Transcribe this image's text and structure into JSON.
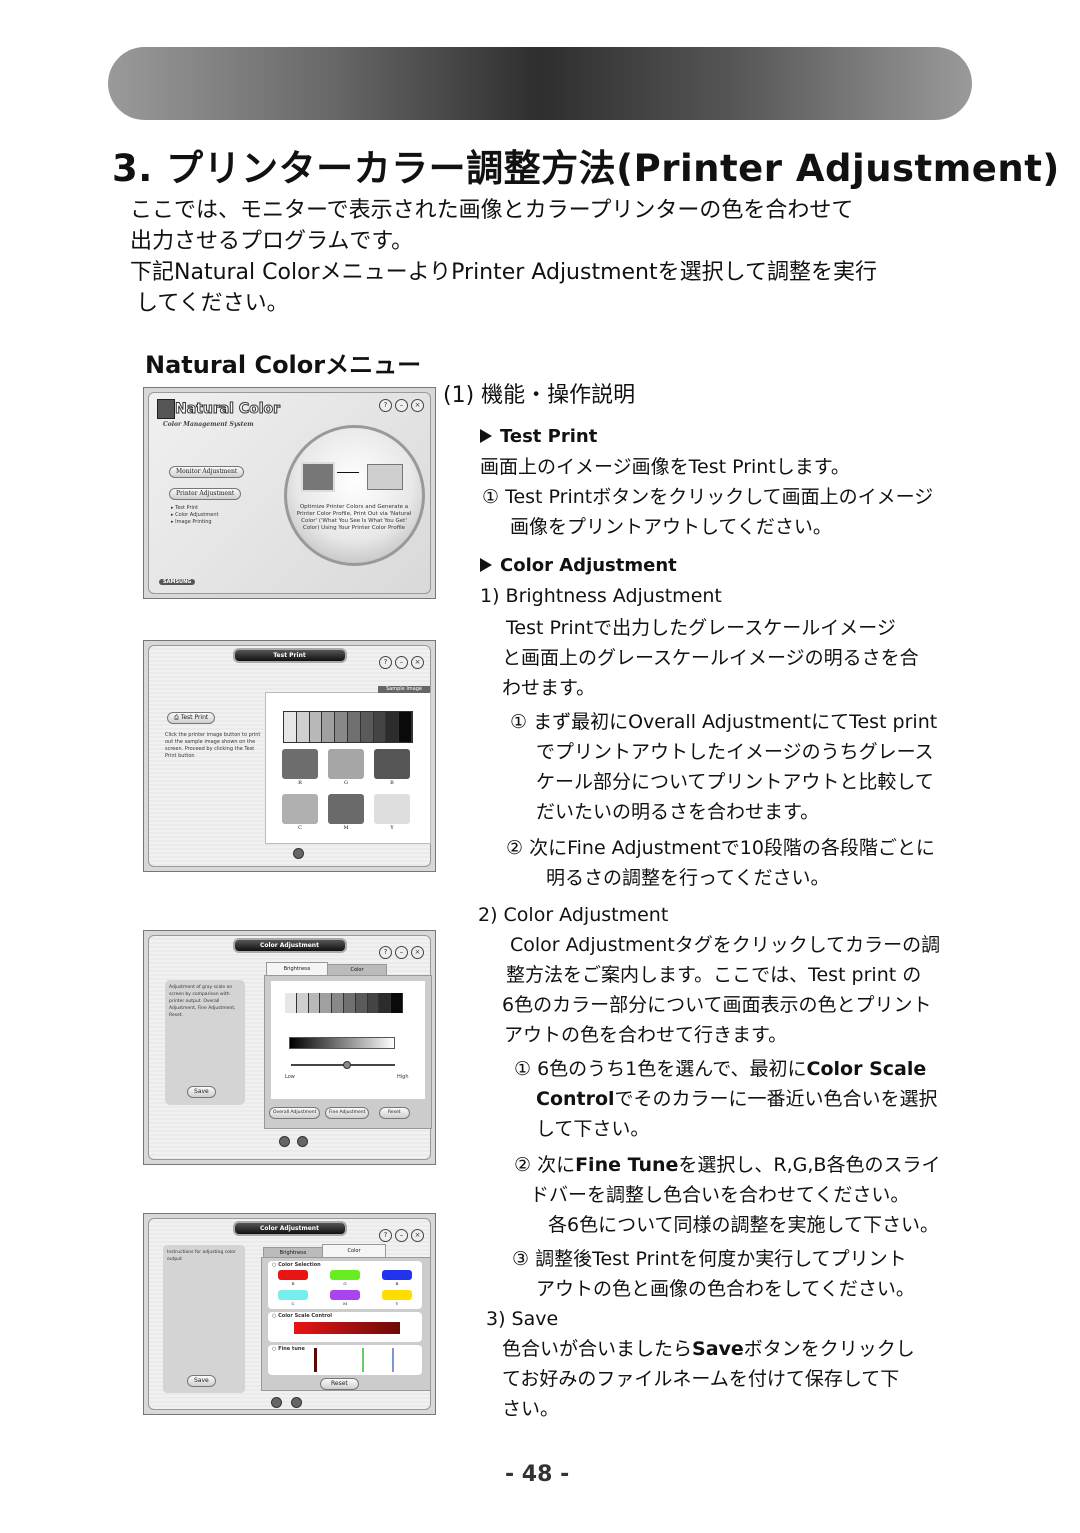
{
  "header": {
    "title": "3. プリンターカラー調整方法(Printer Adjustment)"
  },
  "intro": {
    "lines": [
      "ここでは、モニターで表示された画像とカラープリンターの色を合わせて",
      "出力させるプログラムです。",
      "下記Natural ColorメニューよりPrinter Adjustmentを選択して調整を実行",
      "してください。"
    ]
  },
  "menu_heading": "Natural Colorメニュー",
  "function_heading": "(1) 機能・操作説明",
  "sections": {
    "test_print": {
      "title": "Test Print",
      "lines": [
        "画面上のイメージ画像をTest Printします。",
        "① Test Printボタンをクリックして画面上のイメージ",
        "画像をプリントアウトしてください。"
      ]
    },
    "color_adjustment": {
      "title": "Color Adjustment",
      "brightness": {
        "heading": "1) Brightness Adjustment",
        "lines": [
          "Test Printで出力したグレースケールイメージ",
          "と画面上のグレースケールイメージの明るさを合",
          "わせます。"
        ],
        "step1": [
          "① まず最初にOverall AdjustmentにてTest print",
          "でプリントアウトしたイメージのうちグレース",
          "ケール部分についてプリントアウトと比較して",
          "だいたいの明るさを合わせます。"
        ],
        "step2": [
          "② 次にFine Adjustmentで10段階の各段階ごとに",
          "明るさの調整を行ってください。"
        ]
      },
      "color": {
        "heading": "2) Color Adjustment",
        "lines": [
          "Color Adjustmentタグをクリックしてカラーの調",
          "整方法をご案内します。ここでは、Test print の",
          "6色のカラー部分について画面表示の色とプリント",
          "アウトの色を合わせて行きます。"
        ],
        "step1_prefix": "① 6色のうち1色を選んで、最初に",
        "step1_kw1": "Color Scale",
        "step1_kw2": "Control",
        "step1_mid": "でそのカラーに一番近い色合いを選択",
        "step1_end": "して下さい。",
        "step2_prefix": "② 次に",
        "step2_kw": "Fine Tune",
        "step2_mid": "を選択し、R,G,B各色のスライ",
        "step2_l2": "ドバーを調整し色合いを合わせてください。",
        "step2_l3": "各6色について同様の調整を実施して下さい。",
        "step3": [
          "③ 調整後Test Printを何度か実行してプリント",
          "アウトの色と画像の色合わをしてください。"
        ]
      },
      "save": {
        "heading": "3) Save",
        "l1_prefix": "色合いが合いましたら",
        "l1_kw": "Save",
        "l1_suffix": "ボタンをクリックし",
        "l2": "てお好みのファイルネームを付けて保存して下",
        "l3": "さい。"
      }
    }
  },
  "screens": {
    "main_menu": {
      "logo": "Natural Color",
      "subtitle": "Color Management System",
      "buttons": [
        "Monitor Adjustment",
        "Printer Adjustment"
      ],
      "sub_items": [
        "Test Print",
        "Color Adjustment",
        "Image Printing"
      ],
      "description": "Optimize Printer Colors and Generate a Printer Color Profile, Print Out via 'Natural Color' ('What You See Is What You Get' Color) Using Your Printer Color Profile",
      "brand": "SAMSUNG"
    },
    "test_print": {
      "title": "Test Print",
      "button": "Test Print",
      "help": "Click the printer image button to print out the sample image shown on the screen. Proceed by clicking the Test Print button",
      "panel_tab": "Sample Image",
      "grayscale": [
        "#e6e6e6",
        "#cfcfcf",
        "#b8b8b8",
        "#a0a0a0",
        "#888888",
        "#707070",
        "#5a5a5a",
        "#444444",
        "#2c2c2c",
        "#0a0a0a"
      ],
      "swatches": [
        {
          "label": "R",
          "color": "#6d6d6d"
        },
        {
          "label": "G",
          "color": "#a6a6a6"
        },
        {
          "label": "B",
          "color": "#555555"
        },
        {
          "label": "C",
          "color": "#b0b0b0"
        },
        {
          "label": "M",
          "color": "#6a6a6a"
        },
        {
          "label": "Y",
          "color": "#dedede"
        }
      ]
    },
    "brightness": {
      "title": "Color Adjustment",
      "tabs": [
        "Brightness",
        "Color"
      ],
      "help": "Adjustment of gray scale on screen by comparison with printer output. Overall Adjustment, Fine Adjustment, Reset.",
      "save_button": "Save",
      "low_label": "Low",
      "high_label": "High",
      "buttons": [
        "Overall Adjustment",
        "Fine Adjustment",
        "Reset"
      ],
      "slider_value": 0.5
    },
    "color": {
      "title": "Color Adjustment",
      "tabs": [
        "Brightness",
        "Color"
      ],
      "help_title": "Instructions for adjusting color output",
      "save_button": "Save",
      "sections": [
        "Color Selection",
        "Color Scale Control",
        "Fine tune"
      ],
      "colors": [
        {
          "label": "R",
          "color": "#e81515"
        },
        {
          "label": "G",
          "color": "#66ee22"
        },
        {
          "label": "B",
          "color": "#2233ee"
        },
        {
          "label": "C",
          "color": "#77eeee"
        },
        {
          "label": "M",
          "color": "#aa44ee"
        },
        {
          "label": "Y",
          "color": "#ffdd00"
        }
      ],
      "fine_tune_labels": [
        "R",
        "G",
        "B"
      ],
      "reset_button": "Reset"
    }
  },
  "page_number": "- 48 -"
}
